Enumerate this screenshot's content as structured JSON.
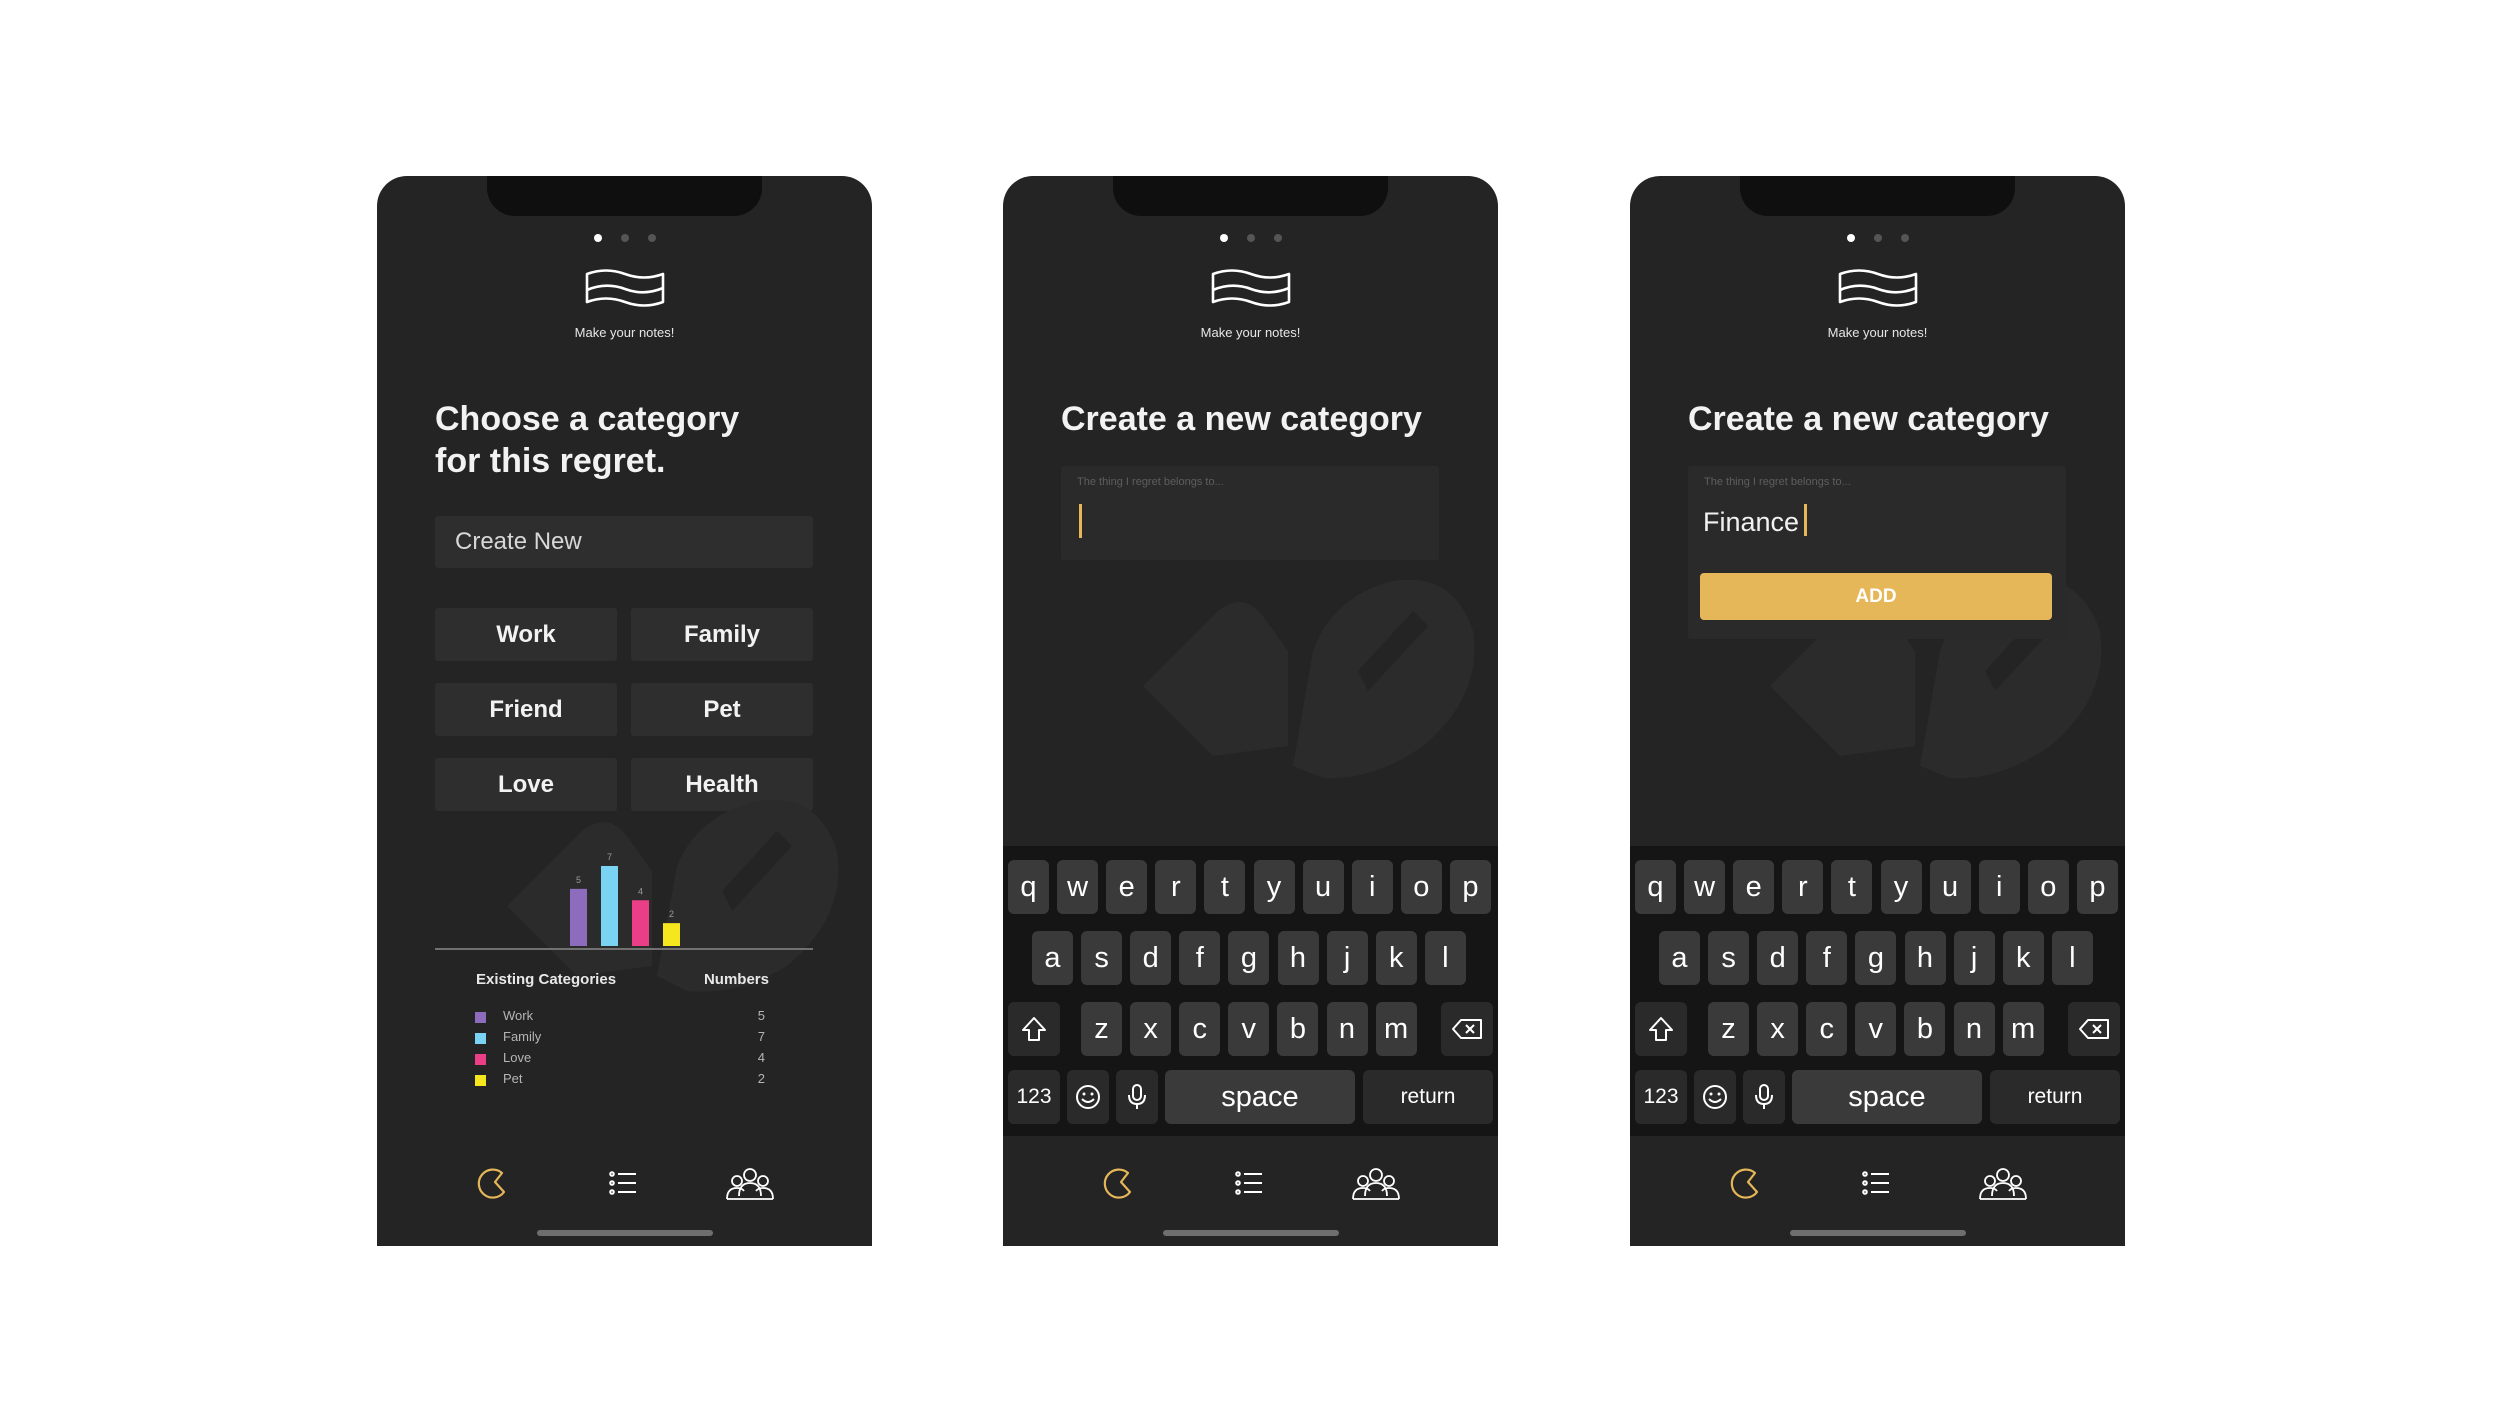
{
  "colors": {
    "screen_bg": "#242424",
    "accent": "#e6b758",
    "work": "#8d6bbd",
    "family": "#7ad3f3",
    "love": "#ea3f86",
    "pet": "#f5e61e"
  },
  "icons": {
    "logo": "wavy-banner-icon",
    "tab_home": "moon-icon",
    "tab_list": "list-icon",
    "tab_community": "people-icon",
    "watermark": "thumbs-icon"
  },
  "screen1": {
    "tagline": "Make your notes!",
    "title_line1": "Choose a category",
    "title_line2": "for this regret.",
    "create_new": "Create New",
    "categories": [
      "Work",
      "Family",
      "Friend",
      "Pet",
      "Love",
      "Health"
    ],
    "legend": {
      "header_left": "Existing Categories",
      "header_right": "Numbers",
      "items": [
        {
          "label": "Work",
          "value": "5"
        },
        {
          "label": "Family",
          "value": "7"
        },
        {
          "label": "Love",
          "value": "4"
        },
        {
          "label": "Pet",
          "value": "2"
        }
      ]
    }
  },
  "chart_data": {
    "type": "bar",
    "categories": [
      "Work",
      "Family",
      "Love",
      "Pet"
    ],
    "values": [
      5,
      7,
      4,
      2
    ],
    "data_labels": [
      "5",
      "7",
      "4",
      "2"
    ],
    "colors": [
      "#8d6bbd",
      "#7ad3f3",
      "#ea3f86",
      "#f5e61e"
    ],
    "ylim": [
      0,
      7
    ],
    "title": "",
    "xlabel": "",
    "ylabel": "",
    "grid": false
  },
  "screen2": {
    "tagline": "Make your notes!",
    "title": "Create a new category",
    "input_placeholder": "The thing I regret belongs to...",
    "input_value": ""
  },
  "screen3": {
    "tagline": "Make your notes!",
    "title": "Create a new category",
    "input_placeholder": "The thing I regret belongs to...",
    "input_value": "Finance",
    "add_label": "ADD"
  },
  "keyboard": {
    "row1": [
      "q",
      "w",
      "e",
      "r",
      "t",
      "y",
      "u",
      "i",
      "o",
      "p"
    ],
    "row2": [
      "a",
      "s",
      "d",
      "f",
      "g",
      "h",
      "j",
      "k",
      "l"
    ],
    "row3": [
      "z",
      "x",
      "c",
      "v",
      "b",
      "n",
      "m"
    ],
    "numbers_label": "123",
    "space_label": "space",
    "return_label": "return"
  }
}
